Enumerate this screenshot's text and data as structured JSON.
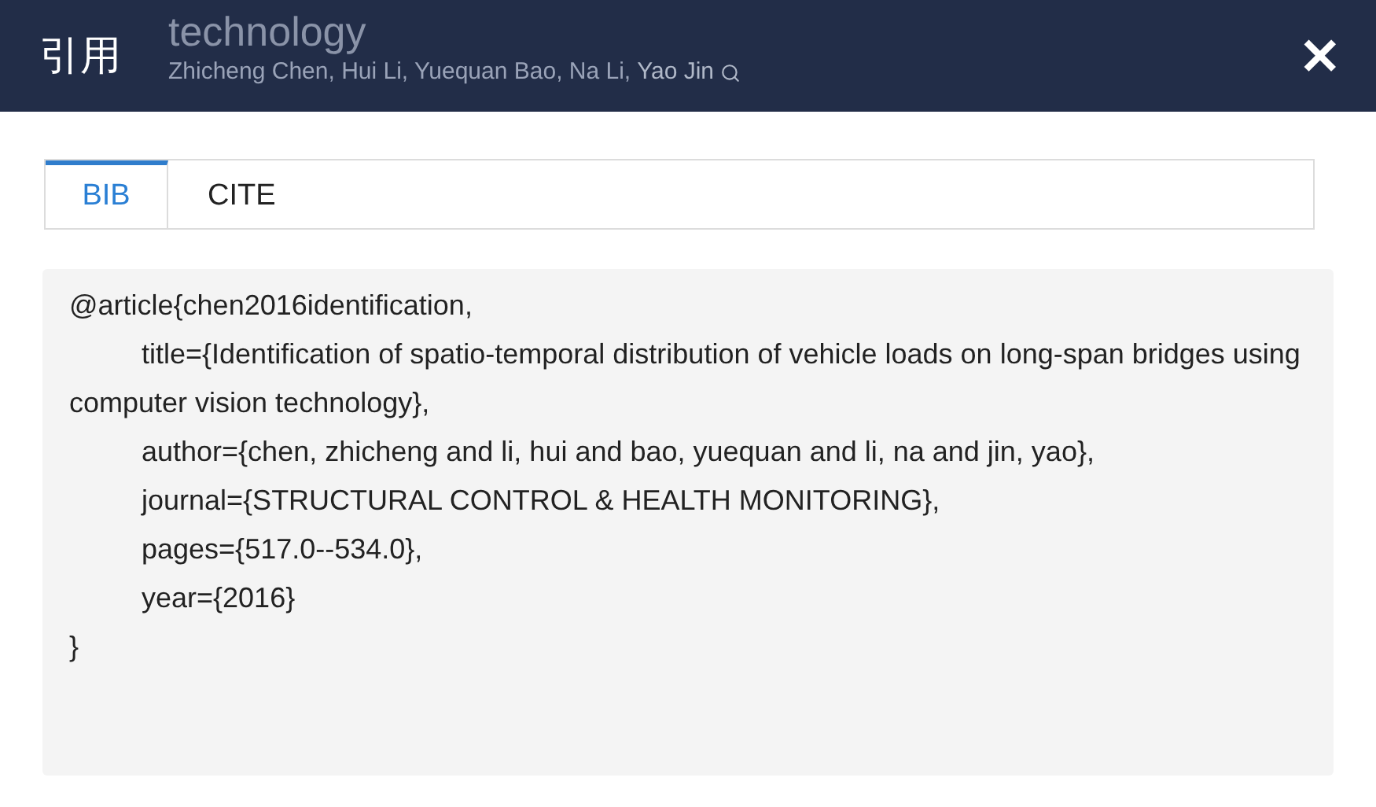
{
  "background_page": {
    "title_fragment": "technology",
    "authors": "Zhicheng Chen, Hui Li, Yuequan Bao, Na Li,",
    "author_last": "Yao Jin"
  },
  "dialog": {
    "title": "引用",
    "close": "✕"
  },
  "tabs": [
    {
      "label": "BIB",
      "selected": true
    },
    {
      "label": "CITE",
      "selected": false
    }
  ],
  "citation_lines": [
    {
      "kind": "open",
      "text": "@article{chen2016identification,"
    },
    {
      "kind": "field",
      "text": "title={Identification of spatio-temporal distribution of vehicle loads on long-span bridges using computer vision technology},"
    },
    {
      "kind": "field",
      "text": "author={chen, zhicheng and li, hui and bao, yuequan and li, na and jin, yao},"
    },
    {
      "kind": "field",
      "text": "journal={STRUCTURAL CONTROL & HEALTH MONITORING},"
    },
    {
      "kind": "field",
      "text": "pages={517.0--534.0},"
    },
    {
      "kind": "field",
      "text": "year={2016}"
    },
    {
      "kind": "close",
      "text": "}"
    }
  ]
}
